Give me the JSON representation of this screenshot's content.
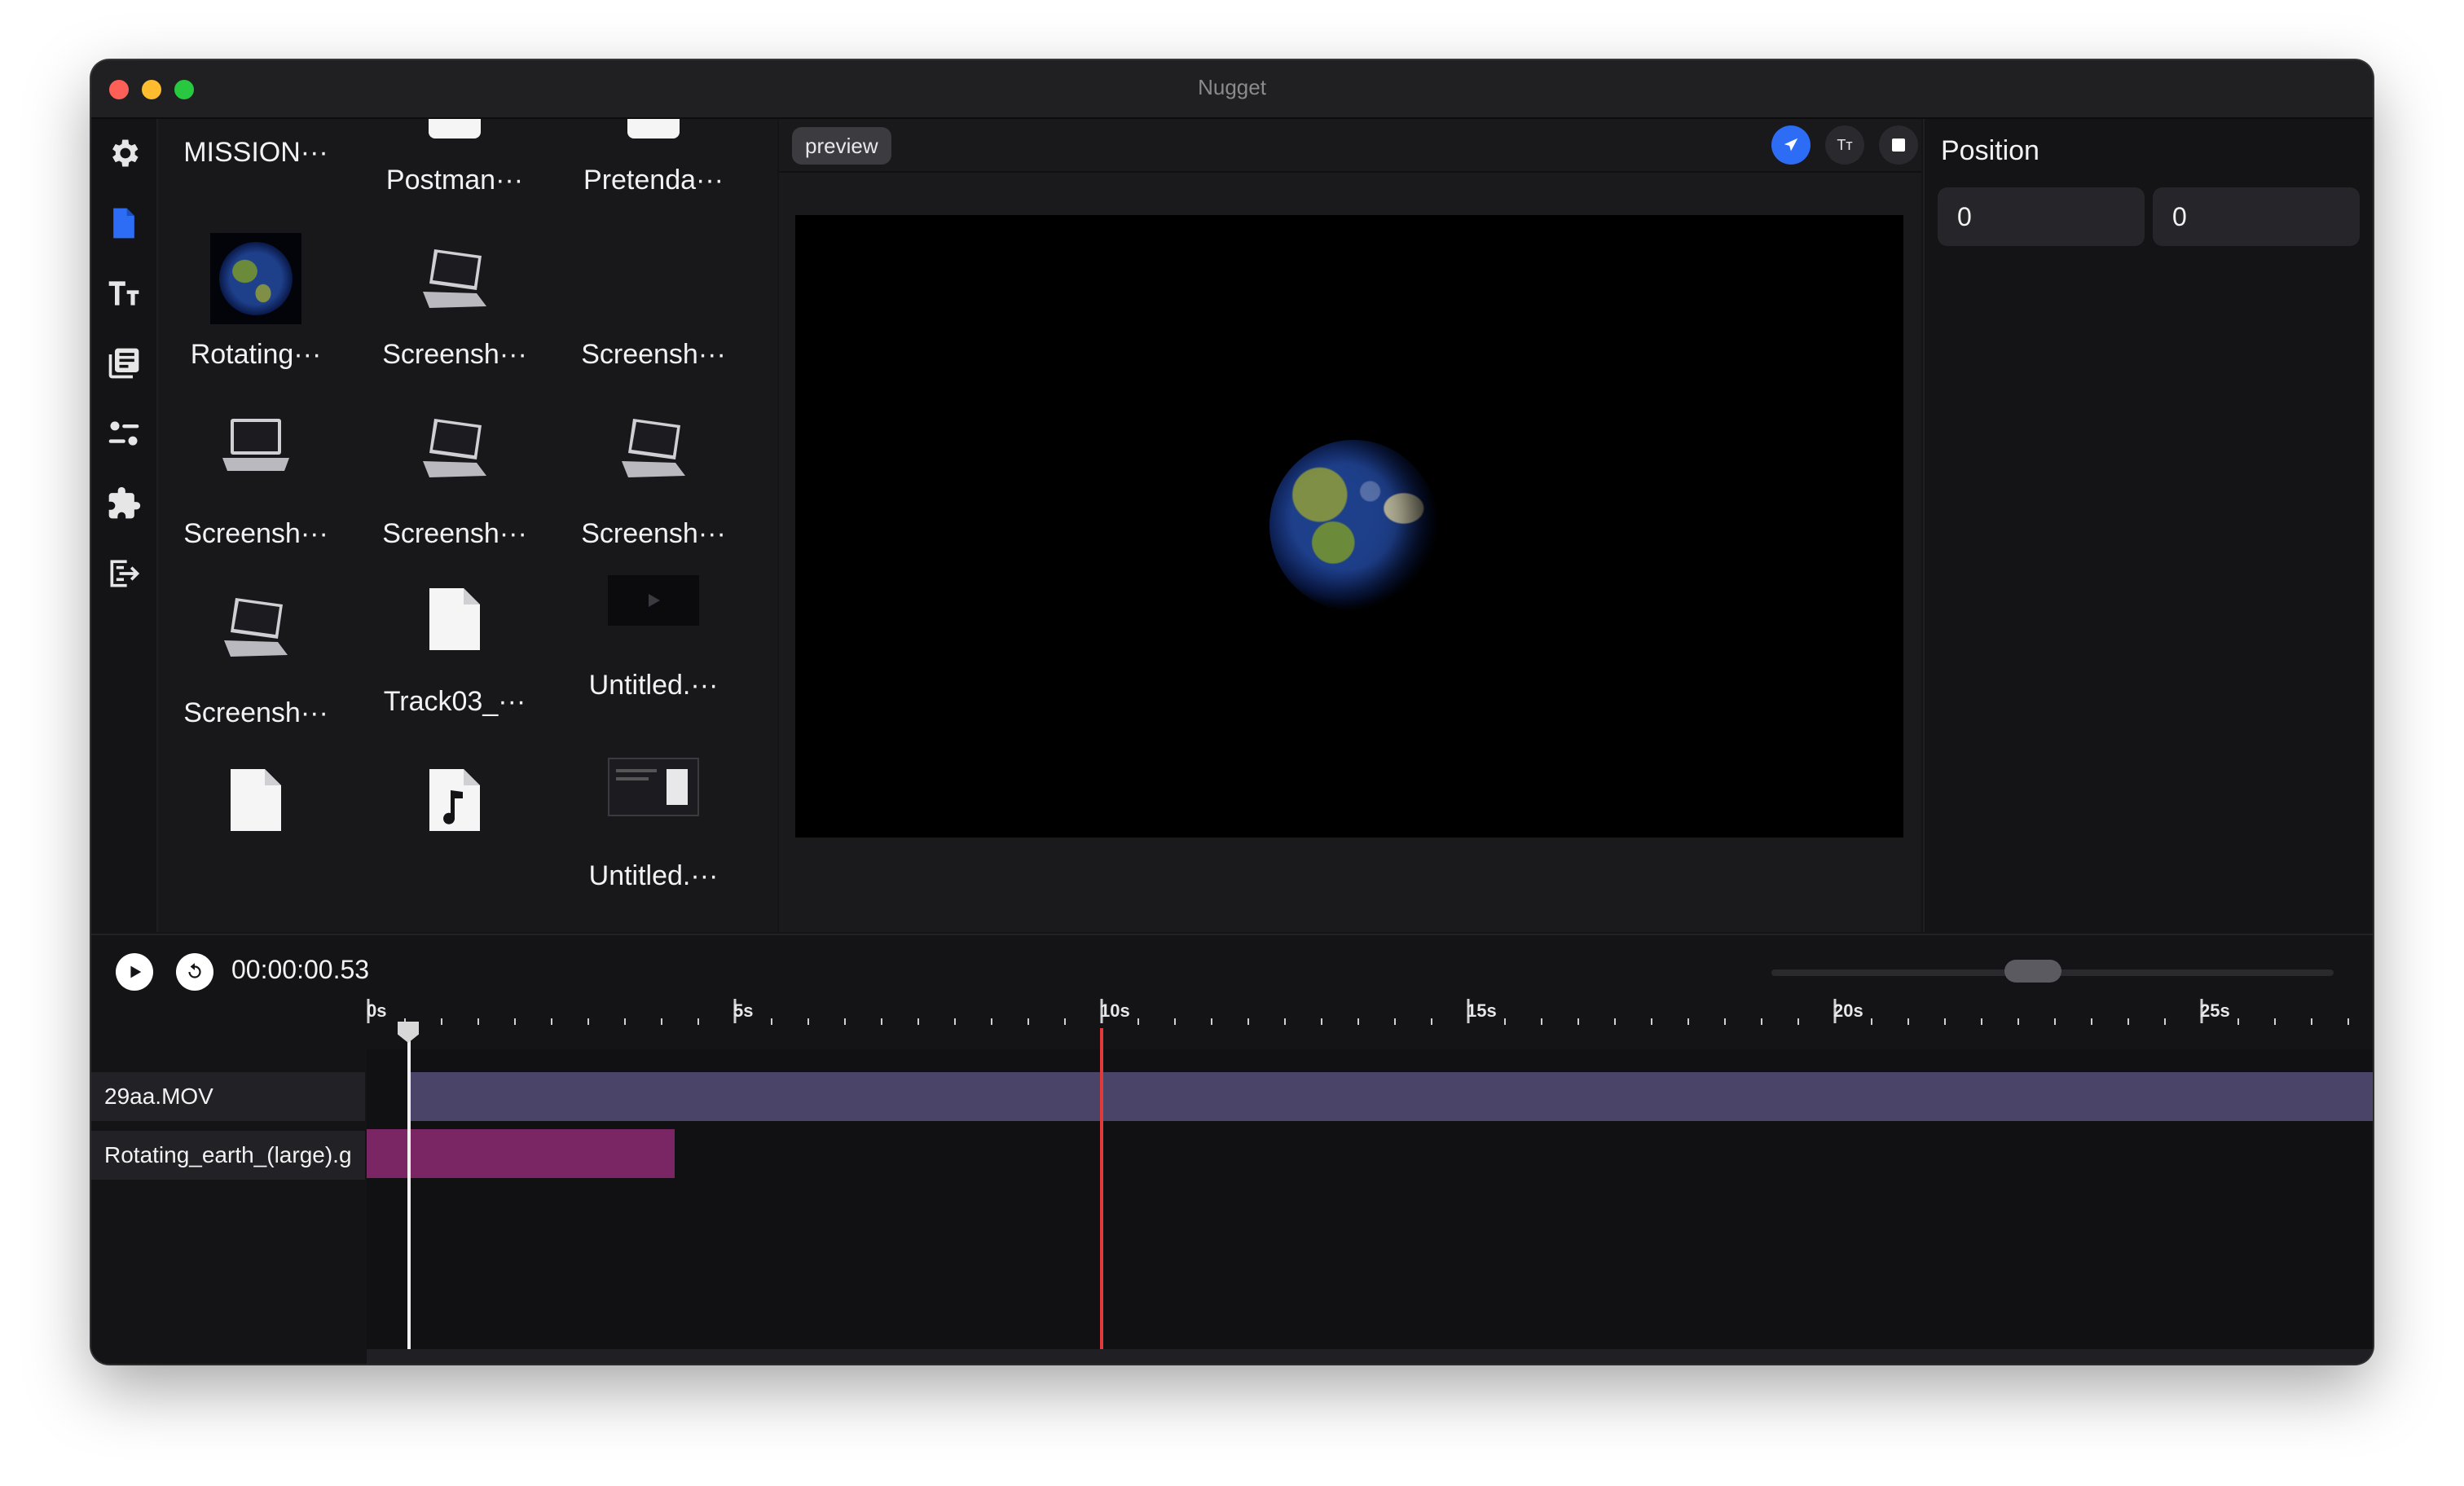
{
  "window": {
    "title": "Nugget"
  },
  "sidebar": {
    "icons": [
      "gear-icon",
      "file-icon",
      "text-icon",
      "library-icon",
      "sliders-icon",
      "puzzle-icon",
      "export-icon"
    ],
    "active": "file-icon",
    "accent": "#2d6cf5"
  },
  "library": {
    "items": [
      {
        "label": "MISSION···",
        "thumb": "none"
      },
      {
        "label": "Postman···",
        "thumb": "white-card"
      },
      {
        "label": "Pretenda···",
        "thumb": "white-card"
      },
      {
        "label": "Rotating···",
        "thumb": "earth"
      },
      {
        "label": "Screensh···",
        "thumb": "laptop"
      },
      {
        "label": "Screensh···",
        "thumb": "none"
      },
      {
        "label": "Screensh···",
        "thumb": "laptop"
      },
      {
        "label": "Screensh···",
        "thumb": "laptop"
      },
      {
        "label": "Screensh···",
        "thumb": "laptop"
      },
      {
        "label": "Screensh···",
        "thumb": "laptop"
      },
      {
        "label": "Track03_···",
        "thumb": "document"
      },
      {
        "label": "Untitled.···",
        "thumb": "video"
      },
      {
        "label": "",
        "thumb": "document"
      },
      {
        "label": "",
        "thumb": "music"
      },
      {
        "label": "Untitled.···",
        "thumb": "screenshot"
      }
    ]
  },
  "preview": {
    "tab_label": "preview",
    "tools": [
      "pointer-tool",
      "text-tool",
      "stop-tool"
    ],
    "text_tool_label": "Tт"
  },
  "inspector": {
    "title": "Position",
    "x_value": "0",
    "y_value": "0"
  },
  "timeline": {
    "timecode": "00:00:00.53",
    "ruler_labels": [
      "0s",
      "5s",
      "10s",
      "15s",
      "20s",
      "25s"
    ],
    "tracks": [
      {
        "name": "29aa.MOV",
        "color": "#4a4468"
      },
      {
        "name": "Rotating_earth_(large).g",
        "color": "#7a2564"
      }
    ],
    "playhead_seconds": 0.53,
    "marker_seconds": 10,
    "marker_color": "#e03a3a"
  }
}
